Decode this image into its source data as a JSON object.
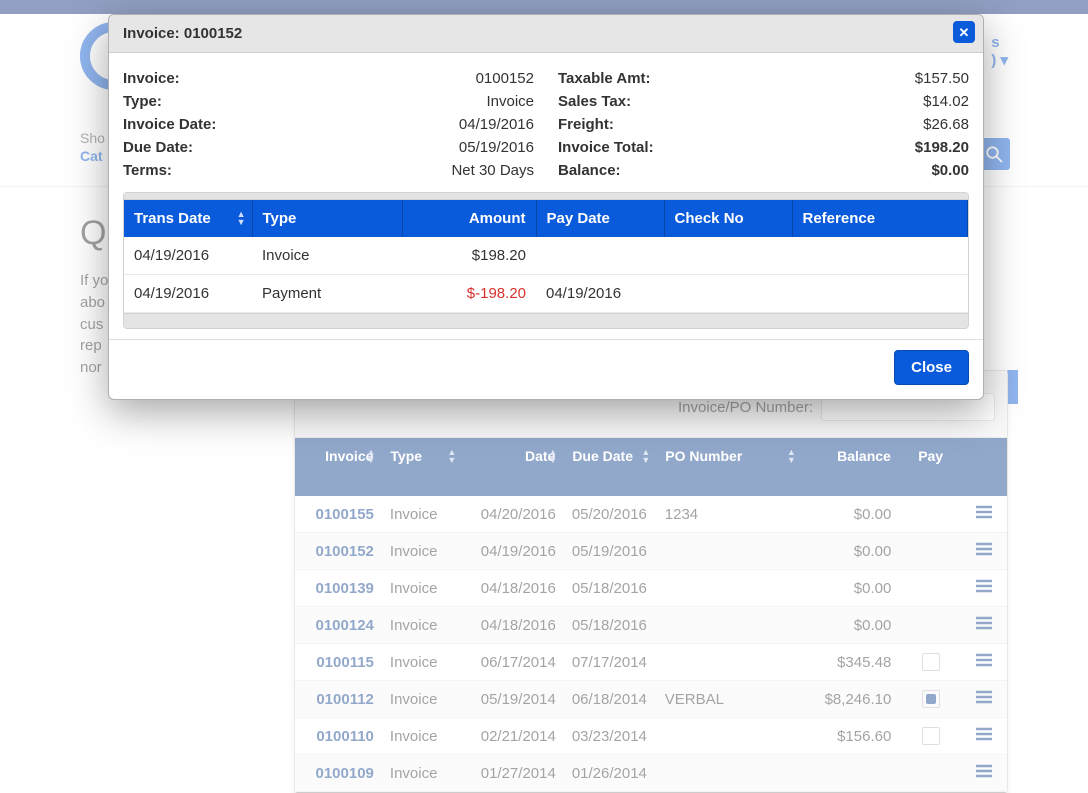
{
  "modal": {
    "title": "Invoice: 0100152",
    "close_label": "Close",
    "left": [
      {
        "label": "Invoice:",
        "value": "0100152"
      },
      {
        "label": "Type:",
        "value": "Invoice"
      },
      {
        "label": "Invoice Date:",
        "value": "04/19/2016"
      },
      {
        "label": "Due Date:",
        "value": "05/19/2016"
      },
      {
        "label": "Terms:",
        "value": "Net 30 Days"
      }
    ],
    "right": [
      {
        "label": "Taxable Amt:",
        "value": "$157.50",
        "bold": false
      },
      {
        "label": "Sales Tax:",
        "value": "$14.02",
        "bold": false
      },
      {
        "label": "Freight:",
        "value": "$26.68",
        "bold": false
      },
      {
        "label": "Invoice Total:",
        "value": "$198.20",
        "bold": true
      },
      {
        "label": "Balance:",
        "value": "$0.00",
        "bold": true
      }
    ],
    "trans_headers": {
      "date": "Trans Date",
      "type": "Type",
      "amount": "Amount",
      "pay_date": "Pay Date",
      "check": "Check No",
      "ref": "Reference"
    },
    "trans_rows": [
      {
        "date": "04/19/2016",
        "type": "Invoice",
        "amount": "$198.20",
        "neg": false,
        "pay_date": "",
        "check": "",
        "ref": ""
      },
      {
        "date": "04/19/2016",
        "type": "Payment",
        "amount": "$-198.20",
        "neg": true,
        "pay_date": "04/19/2016",
        "check": "",
        "ref": ""
      }
    ]
  },
  "bg": {
    "subnav1": "Sho",
    "subnav2": "Cat",
    "title": "Q",
    "text": [
      "If yo",
      "abo",
      "cus",
      "rep",
      "nor"
    ]
  },
  "list": {
    "filter_label": "Invoice/PO Number:",
    "headers": {
      "invoice": "Invoice",
      "type": "Type",
      "date": "Date",
      "due": "Due Date",
      "po": "PO Number",
      "balance": "Balance",
      "pay": "Pay"
    },
    "rows": [
      {
        "inv": "0100155",
        "type": "Invoice",
        "date": "04/20/2016",
        "due": "05/20/2016",
        "po": "1234",
        "balance": "$0.00",
        "pay": null
      },
      {
        "inv": "0100152",
        "type": "Invoice",
        "date": "04/19/2016",
        "due": "05/19/2016",
        "po": "",
        "balance": "$0.00",
        "pay": null
      },
      {
        "inv": "0100139",
        "type": "Invoice",
        "date": "04/18/2016",
        "due": "05/18/2016",
        "po": "",
        "balance": "$0.00",
        "pay": null
      },
      {
        "inv": "0100124",
        "type": "Invoice",
        "date": "04/18/2016",
        "due": "05/18/2016",
        "po": "",
        "balance": "$0.00",
        "pay": null
      },
      {
        "inv": "0100115",
        "type": "Invoice",
        "date": "06/17/2014",
        "due": "07/17/2014",
        "po": "",
        "balance": "$345.48",
        "pay": false
      },
      {
        "inv": "0100112",
        "type": "Invoice",
        "date": "05/19/2014",
        "due": "06/18/2014",
        "po": "VERBAL",
        "balance": "$8,246.10",
        "pay": true
      },
      {
        "inv": "0100110",
        "type": "Invoice",
        "date": "02/21/2014",
        "due": "03/23/2014",
        "po": "",
        "balance": "$156.60",
        "pay": false
      },
      {
        "inv": "0100109",
        "type": "Invoice",
        "date": "01/27/2014",
        "due": "01/26/2014",
        "po": "",
        "balance": "",
        "pay": null
      }
    ]
  }
}
